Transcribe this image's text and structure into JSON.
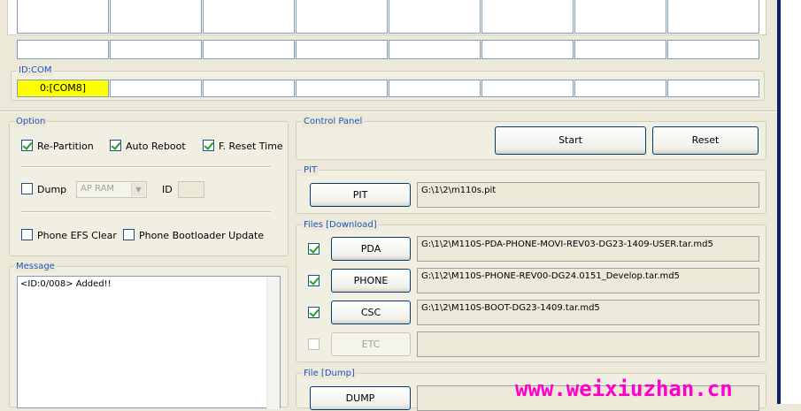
{
  "id_com": {
    "label": "ID:COM",
    "port_text": "0:[COM8]"
  },
  "option": {
    "label": "Option",
    "re_partition": "Re-Partition",
    "auto_reboot": "Auto Reboot",
    "f_reset_time": "F. Reset Time",
    "dump": "Dump",
    "ap_ram": "AP RAM",
    "id": "ID",
    "phone_efs_clear": "Phone EFS Clear",
    "phone_bootloader_update": "Phone Bootloader Update"
  },
  "message": {
    "label": "Message",
    "text": "<ID:0/008> Added!!"
  },
  "control_panel": {
    "label": "Control Panel",
    "start": "Start",
    "reset": "Reset"
  },
  "pit": {
    "label": "PIT",
    "button": "PIT",
    "path": "G:\\1\\2\\m110s.pit"
  },
  "files": {
    "label": "Files [Download]",
    "pda": "PDA",
    "pda_path": "G:\\1\\2\\M110S-PDA-PHONE-MOVI-REV03-DG23-1409-USER.tar.md5",
    "phone": "PHONE",
    "phone_path": "G:\\1\\2\\M110S-PHONE-REV00-DG24.0151_Develop.tar.md5",
    "csc": "CSC",
    "csc_path": "G:\\1\\2\\M110S-BOOT-DG23-1409.tar.md5",
    "etc": "ETC",
    "etc_path": ""
  },
  "file_dump": {
    "label": "File [Dump]",
    "button": "DUMP"
  },
  "watermark": "www.weixiuzhan.cn",
  "colors": {
    "window_bg": "#ece9d8",
    "group_label": "#1a52c1",
    "selected_port": "#ffff00",
    "watermark": "#ff00cc"
  }
}
